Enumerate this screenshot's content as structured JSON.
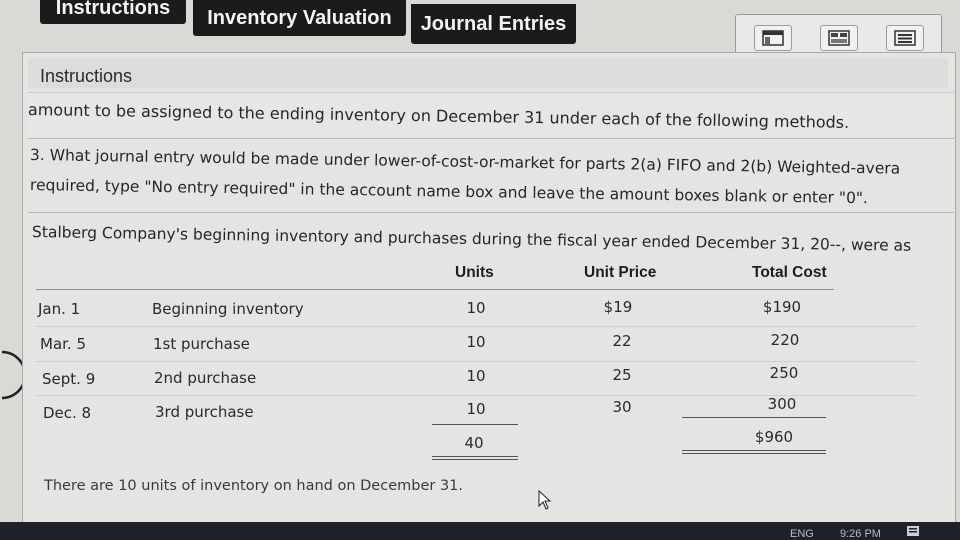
{
  "tabs": [
    {
      "label": "Instructions"
    },
    {
      "label": "Inventory Valuation"
    },
    {
      "label": "Journal Entries"
    }
  ],
  "panel": {
    "title": "Instructions",
    "line1": "amount to be assigned to the ending inventory on December 31 under each of the following methods.",
    "q3_line1": "3. What journal entry would be made under lower-of-cost-or-market for parts 2(a) FIFO and 2(b) Weighted-avera",
    "q3_line2": "required, type \"No entry required\" in the account name box and leave the amount boxes blank or enter \"0\".",
    "intro": "Stalberg Company's beginning inventory and purchases during the fiscal year ended December 31, 20--, were as"
  },
  "table": {
    "headers": {
      "units": "Units",
      "unit_price": "Unit Price",
      "total_cost": "Total Cost"
    },
    "rows": [
      {
        "date": "Jan. 1",
        "desc": "Beginning inventory",
        "units": "10",
        "price": "$19",
        "cost": "$190"
      },
      {
        "date": "Mar. 5",
        "desc": "1st purchase",
        "units": "10",
        "price": "22",
        "cost": "220"
      },
      {
        "date": "Sept. 9",
        "desc": "2nd purchase",
        "units": "10",
        "price": "25",
        "cost": "250"
      },
      {
        "date": "Dec. 8",
        "desc": "3rd purchase",
        "units": "10",
        "price": "30",
        "cost": "300"
      }
    ],
    "total_units": "40",
    "total_cost": "$960"
  },
  "footer_note": "There are 10 units of inventory on hand on December 31.",
  "taskbar": {
    "lang": "ENG",
    "time": "9:26 PM"
  }
}
